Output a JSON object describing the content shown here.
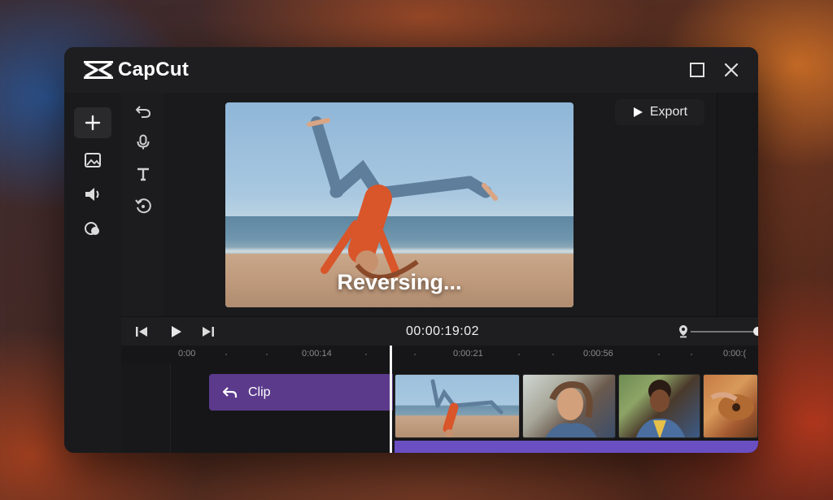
{
  "app": {
    "title": "CapCut"
  },
  "window_controls": {
    "maximize_icon": "square-icon",
    "close_icon": "close-icon"
  },
  "left_rail": {
    "items": [
      {
        "name": "add",
        "icon": "plus-icon",
        "active": true
      },
      {
        "name": "media",
        "icon": "image-icon"
      },
      {
        "name": "audio",
        "icon": "speaker-icon"
      },
      {
        "name": "effects",
        "icon": "effects-icon"
      }
    ]
  },
  "tools": [
    {
      "name": "undo",
      "icon": "undo-icon"
    },
    {
      "name": "voiceover",
      "icon": "microphone-icon"
    },
    {
      "name": "text",
      "icon": "text-icon"
    },
    {
      "name": "reverse",
      "icon": "reverse-icon"
    }
  ],
  "preview": {
    "status": "Reversing..."
  },
  "export": {
    "label": "Export"
  },
  "playback": {
    "timecode": "00:00:19:02",
    "zoom_level_fraction": 0.9
  },
  "timeline": {
    "ruler_labels": [
      "0:00",
      "0:00:14",
      "0:00:21",
      "0:00:56",
      "0:00:("
    ],
    "clip": {
      "label": "Clip"
    }
  },
  "colors": {
    "accent": "#5b3a8c",
    "audio_track": "#6a4fc2",
    "window_bg": "#1b1b1d"
  }
}
